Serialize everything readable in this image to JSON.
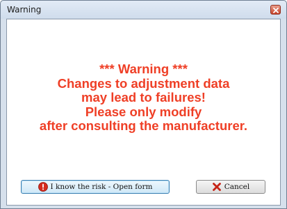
{
  "window": {
    "title": "Warning"
  },
  "message": {
    "lines": [
      "*** Warning ***",
      "Changes to adjustment data",
      "may lead to failures!",
      "Please only modify",
      "after consulting the manufacturer."
    ],
    "color": "#ef3f26"
  },
  "buttons": {
    "open_form_label": "I know the risk - Open form",
    "cancel_label": "Cancel"
  },
  "icons": {
    "close": "close-icon",
    "alert": "alert-icon",
    "cancel": "x-icon"
  }
}
